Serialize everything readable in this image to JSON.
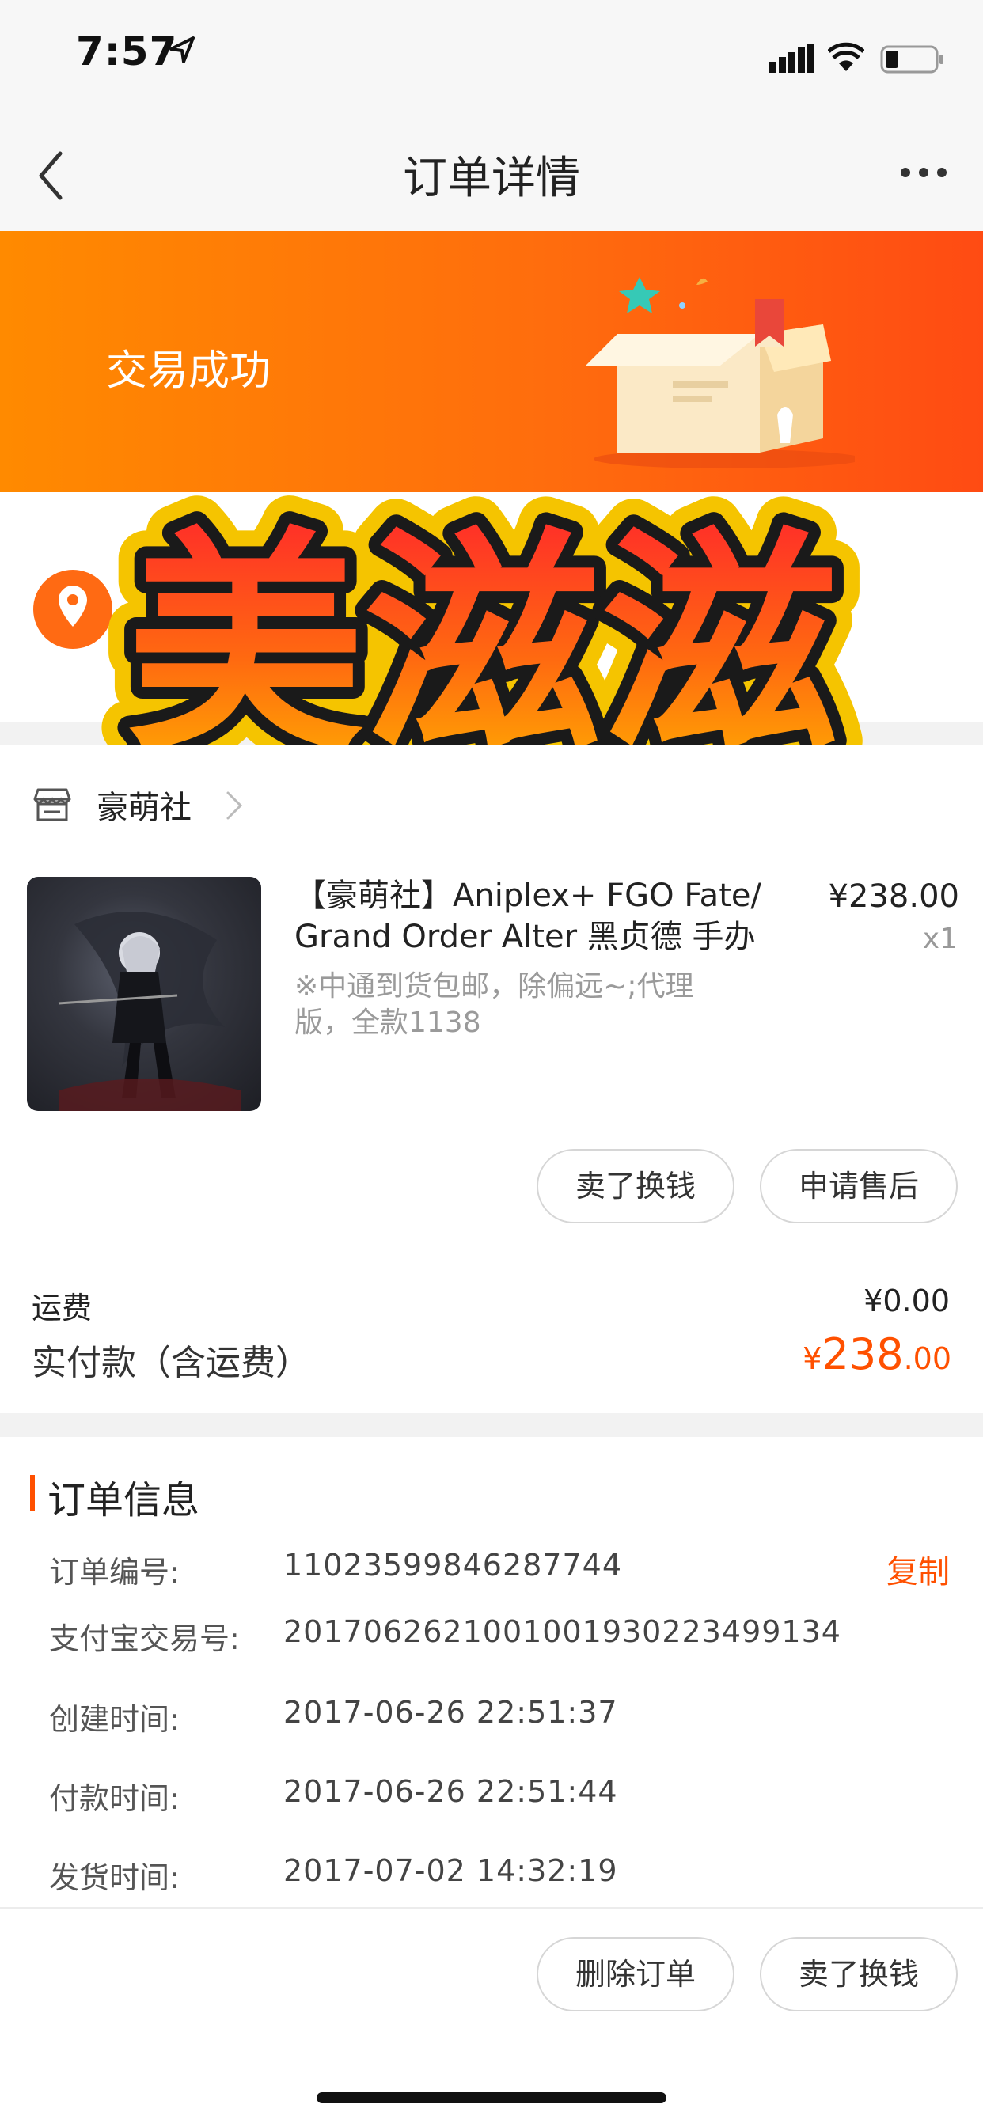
{
  "status": {
    "time": "7:57"
  },
  "nav": {
    "title": "订单详情"
  },
  "banner": {
    "status_text": "交易成功"
  },
  "sticker": {
    "text": "美滋滋"
  },
  "shop": {
    "name": "豪萌社"
  },
  "product": {
    "title": "【豪萌社】Aniplex+ FGO Fate/ Grand Order Alter 黑贞德 手办",
    "price": "¥238.00",
    "quantity": "x1",
    "note": "※中通到货包邮，除偏远~;代理版，全款1138"
  },
  "actions": {
    "sell": "卖了换钱",
    "after_sale": "申请售后",
    "delete": "删除订单"
  },
  "fees": {
    "shipping_label": "运费",
    "shipping_value": "¥0.00",
    "paid_label": "实付款（含运费）",
    "paid_currency": "¥",
    "paid_integer": "238",
    "paid_decimal": ".00"
  },
  "order_info": {
    "title": "订单信息",
    "copy_label": "复制",
    "rows": [
      {
        "label": "订单编号:",
        "value": "11023599846287744"
      },
      {
        "label": "支付宝交易号:",
        "value": "2017062621001001930223499134"
      },
      {
        "label": "创建时间:",
        "value": "2017-06-26 22:51:37"
      },
      {
        "label": "付款时间:",
        "value": "2017-06-26 22:51:44"
      },
      {
        "label": "发货时间:",
        "value": "2017-07-02 14:32:19"
      }
    ]
  },
  "colors": {
    "accent": "#ff5000",
    "banner_start": "#ff8a00",
    "banner_end": "#ff4b13"
  }
}
